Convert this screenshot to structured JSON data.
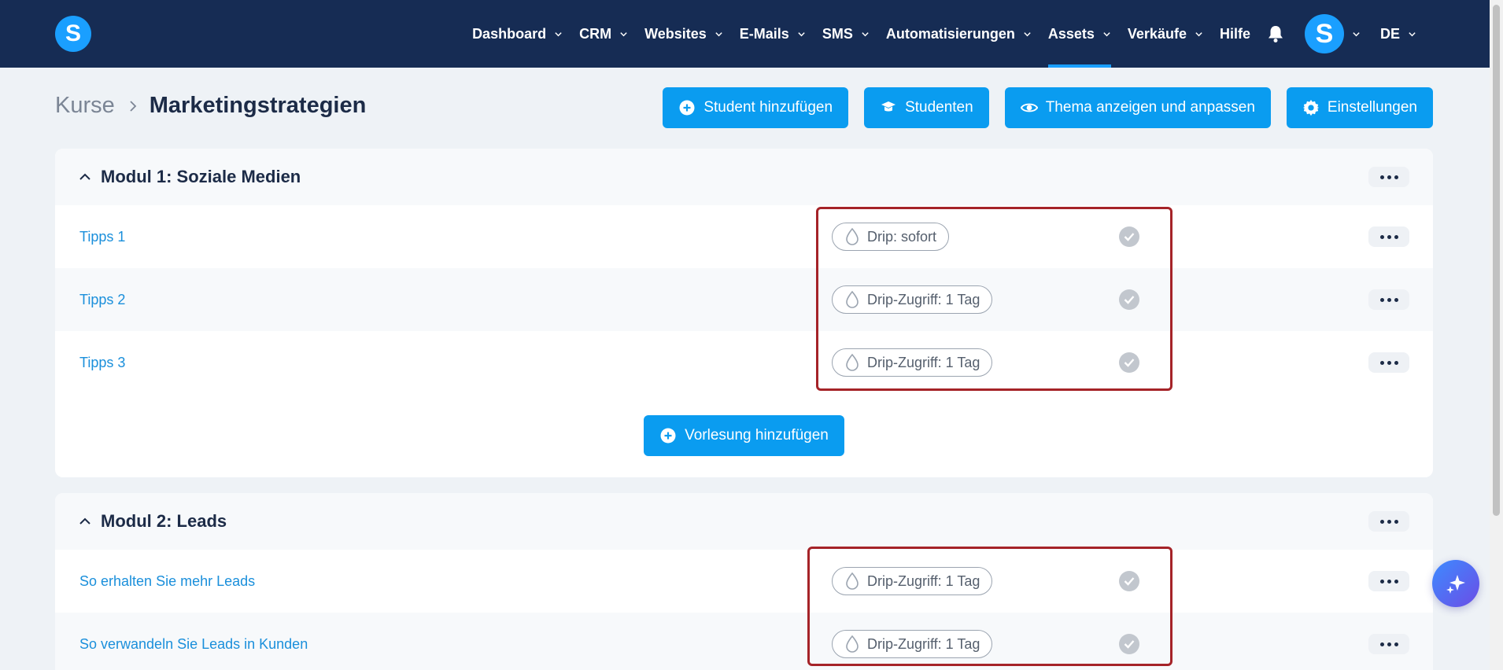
{
  "app": {
    "logo_letter": "S",
    "accent_color": "#1a9fff",
    "nav_bg": "#162c54"
  },
  "nav": {
    "items": [
      {
        "label": "Dashboard",
        "has_dropdown": true,
        "active": false
      },
      {
        "label": "CRM",
        "has_dropdown": true,
        "active": false
      },
      {
        "label": "Websites",
        "has_dropdown": true,
        "active": false
      },
      {
        "label": "E-Mails",
        "has_dropdown": true,
        "active": false
      },
      {
        "label": "SMS",
        "has_dropdown": true,
        "active": false
      },
      {
        "label": "Automatisierungen",
        "has_dropdown": true,
        "active": false
      },
      {
        "label": "Assets",
        "has_dropdown": true,
        "active": true
      },
      {
        "label": "Verkäufe",
        "has_dropdown": true,
        "active": false
      },
      {
        "label": "Hilfe",
        "has_dropdown": false,
        "active": false
      }
    ],
    "notification_icon": "bell-icon",
    "avatar_letter": "S",
    "language": "DE"
  },
  "breadcrumb": {
    "parent": "Kurse",
    "current": "Marketingstrategien"
  },
  "header_buttons": {
    "add_student": "Student hinzufügen",
    "students": "Studenten",
    "theme": "Thema anzeigen und anpassen",
    "settings": "Einstellungen"
  },
  "modules": [
    {
      "title": "Modul 1: Soziale Medien",
      "lessons": [
        {
          "title": "Tipps 1",
          "drip": "Drip: sofort"
        },
        {
          "title": "Tipps 2",
          "drip": "Drip-Zugriff: 1 Tag"
        },
        {
          "title": "Tipps 3",
          "drip": "Drip-Zugriff: 1 Tag"
        }
      ],
      "add_lecture_label": "Vorlesung hinzufügen"
    },
    {
      "title": "Modul 2: Leads",
      "lessons": [
        {
          "title": "So erhalten Sie mehr Leads",
          "drip": "Drip-Zugriff: 1 Tag"
        },
        {
          "title": "So verwandeln Sie Leads in Kunden",
          "drip": "Drip-Zugriff: 1 Tag"
        }
      ]
    }
  ]
}
